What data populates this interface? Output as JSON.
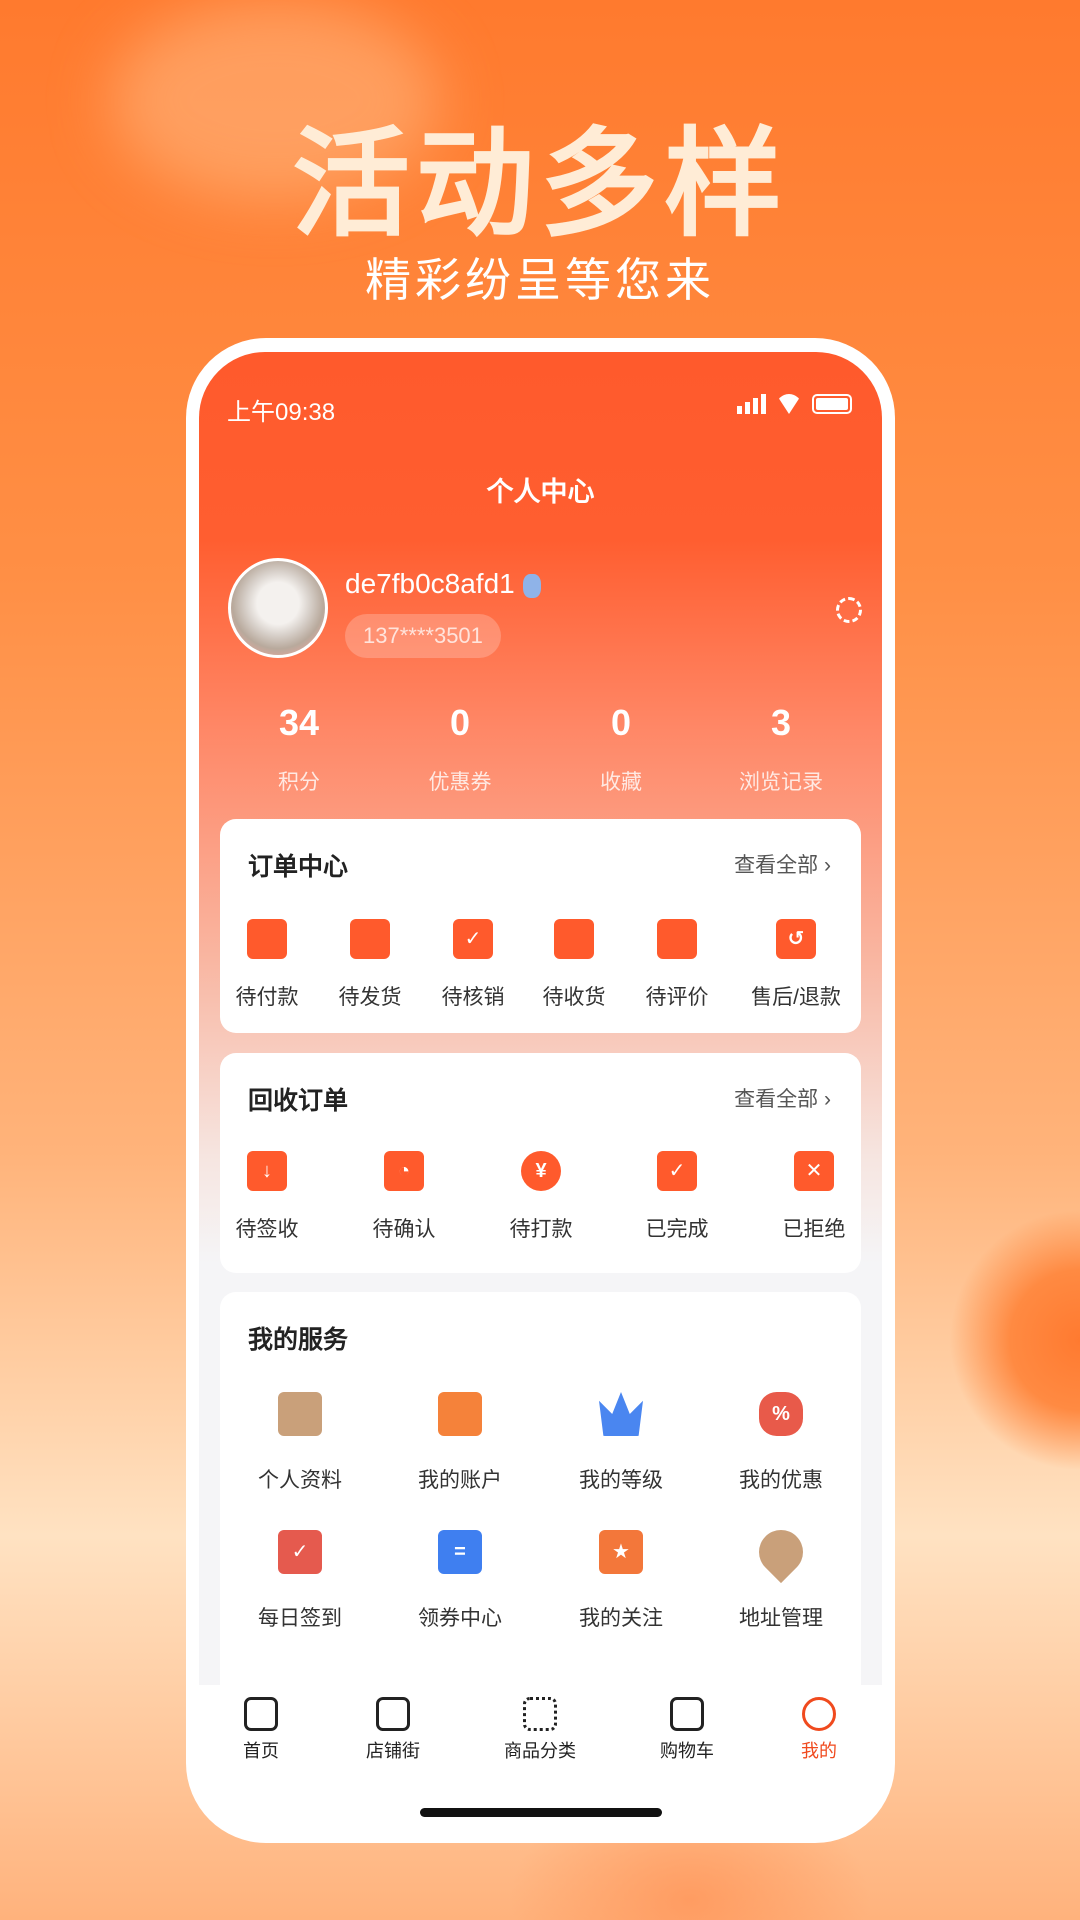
{
  "promo": {
    "headline": "活动多样",
    "subtitle": "精彩纷呈等您来"
  },
  "status": {
    "time": "上午09:38",
    "icons": [
      "signal-icon",
      "wifi-icon",
      "battery-icon"
    ]
  },
  "header": {
    "title": "个人中心"
  },
  "profile": {
    "username": "de7fb0c8afd1",
    "phone": "137****3501",
    "badge": "medal-icon"
  },
  "stats": [
    {
      "value": "34",
      "label": "积分"
    },
    {
      "value": "0",
      "label": "优惠券"
    },
    {
      "value": "0",
      "label": "收藏"
    },
    {
      "value": "3",
      "label": "浏览记录"
    }
  ],
  "orders": {
    "title": "订单中心",
    "more": "查看全部",
    "items": [
      {
        "label": "待付款",
        "icon": "wallet-icon"
      },
      {
        "label": "待发货",
        "icon": "truck-icon"
      },
      {
        "label": "待核销",
        "icon": "calendar-check-icon"
      },
      {
        "label": "待收货",
        "icon": "box-icon"
      },
      {
        "label": "待评价",
        "icon": "comment-icon"
      },
      {
        "label": "售后/退款",
        "icon": "refund-icon"
      }
    ]
  },
  "recycle": {
    "title": "回收订单",
    "more": "查看全部",
    "items": [
      {
        "label": "待签收",
        "icon": "delivery-icon"
      },
      {
        "label": "待确认",
        "icon": "doc-clock-icon"
      },
      {
        "label": "待打款",
        "icon": "money-bag-icon"
      },
      {
        "label": "已完成",
        "icon": "doc-check-icon"
      },
      {
        "label": "已拒绝",
        "icon": "doc-x-icon"
      }
    ]
  },
  "services": {
    "title": "我的服务",
    "items": [
      {
        "label": "个人资料",
        "icon": "profile-icon",
        "color": "#c9a07a"
      },
      {
        "label": "我的账户",
        "icon": "wallet-icon",
        "color": "#f5823a"
      },
      {
        "label": "我的等级",
        "icon": "crown-icon",
        "color": "#4a86f0"
      },
      {
        "label": "我的优惠",
        "icon": "discount-icon",
        "color": "#e85a4a"
      },
      {
        "label": "每日签到",
        "icon": "calendar-check-icon",
        "color": "#e55a4e"
      },
      {
        "label": "领券中心",
        "icon": "ticket-icon",
        "color": "#3f7ff0"
      },
      {
        "label": "我的关注",
        "icon": "star-bookmark-icon",
        "color": "#f3773a"
      },
      {
        "label": "地址管理",
        "icon": "location-icon",
        "color": "#c9a07a"
      }
    ]
  },
  "tabs": [
    {
      "label": "首页",
      "icon": "home-icon"
    },
    {
      "label": "店铺街",
      "icon": "store-icon"
    },
    {
      "label": "商品分类",
      "icon": "grid-icon"
    },
    {
      "label": "购物车",
      "icon": "cart-icon"
    },
    {
      "label": "我的",
      "icon": "smile-icon",
      "active": true
    }
  ],
  "colors": {
    "accent": "#ff5a2c",
    "active_tab": "#f04a1e"
  }
}
